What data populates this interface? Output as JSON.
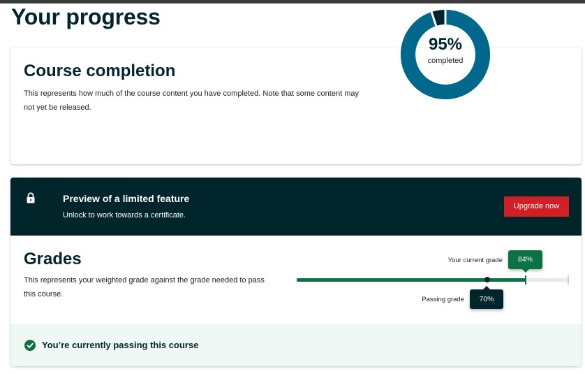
{
  "page": {
    "title": "Your progress"
  },
  "completion": {
    "heading": "Course completion",
    "description": "This represents how much of the course content you have completed. Note that some content may not yet be released.",
    "percent_label": "95%",
    "percent_value": 95,
    "center_caption": "completed",
    "colors": {
      "complete": "#00688d",
      "remaining": "#00262b",
      "gap": "#ffffff"
    }
  },
  "locked_banner": {
    "icon": "lock-icon",
    "title": "Preview of a limited feature",
    "subtitle": "Unlock to work towards a certificate.",
    "button_label": "Upgrade now",
    "colors": {
      "background": "#00262b",
      "button": "#d21f25"
    }
  },
  "grades": {
    "heading": "Grades",
    "description": "This represents your weighted grade against the grade needed to pass this course.",
    "current_grade_label": "Your current grade",
    "current_grade_value": "84%",
    "current_grade_fraction": 0.84,
    "passing_grade_label": "Passing grade",
    "passing_grade_value": "70%",
    "passing_grade_fraction": 0.7,
    "colors": {
      "fill": "#0d7146",
      "passing_marker": "#00262b",
      "track": "#e9e9e9"
    }
  },
  "status": {
    "icon": "check-circle-icon",
    "text": "You’re currently passing this course",
    "colors": {
      "background": "#f0f8f5",
      "icon": "#0d7146"
    }
  }
}
